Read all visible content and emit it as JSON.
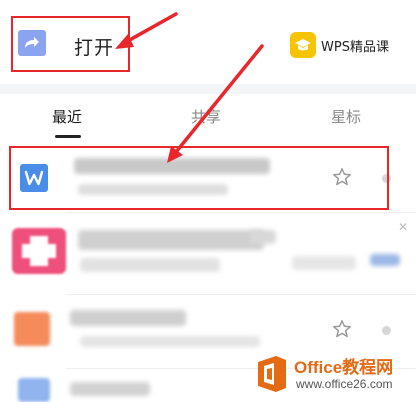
{
  "header": {
    "open_label": "打开",
    "wps_course_label": "WPS精品课"
  },
  "tabs": [
    {
      "label": "最近",
      "active": true
    },
    {
      "label": "共享",
      "active": false
    },
    {
      "label": "星标",
      "active": false
    }
  ],
  "files": [
    {
      "icon": "wps-writer-icon",
      "icon_letter": "W",
      "icon_color": "#4a8de8",
      "name": "",
      "meta": "",
      "starred": false
    },
    {
      "icon": "wps-pdf-icon",
      "icon_color": "#ee4f7b",
      "name": "",
      "meta": "",
      "starred": false
    },
    {
      "icon": "wps-presentation-icon",
      "icon_color": "#f58a5a",
      "name": "",
      "meta": "",
      "starred": false
    },
    {
      "icon": "wps-writer-icon",
      "icon_color": "#4a8de8",
      "name": "",
      "meta": "",
      "starred": false
    }
  ],
  "watermark": {
    "brand": "Office教程网",
    "url": "www.office26.com"
  },
  "colors": {
    "annotation_red": "#e8262b",
    "accent_blue": "#4a8de8",
    "brand_orange": "#e46a14"
  }
}
